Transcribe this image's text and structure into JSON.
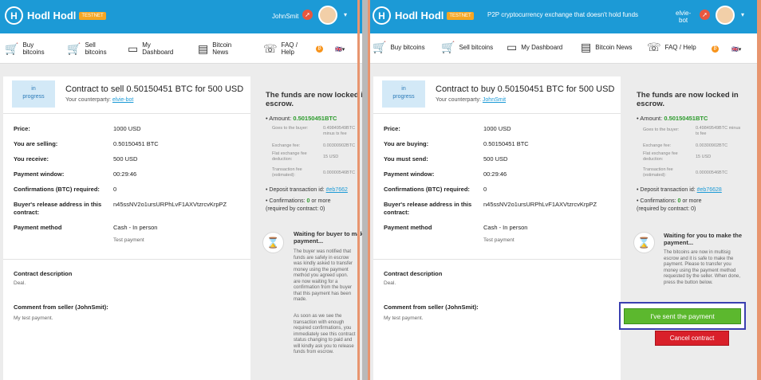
{
  "brand": {
    "name": "Hodl Hodl",
    "badge": "TESTNET"
  },
  "left": {
    "user": "JohnSmit",
    "nav": [
      {
        "label": "Buy\nbitcoins"
      },
      {
        "label": "Sell\nbitcoins"
      },
      {
        "label": "My\nDashboard"
      },
      {
        "label": "Bitcoin\nNews"
      },
      {
        "label": "FAQ /\nHelp"
      }
    ],
    "status": "in\nprogress",
    "title": "Contract to sell 0.50150451 BTC for 500 USD",
    "counterparty_label": "Your counterparty:",
    "counterparty": "elvie-bot",
    "rows": [
      {
        "label": "Price:",
        "value": "1000 USD"
      },
      {
        "label": "You are selling:",
        "value": "0.50150451 BTC"
      },
      {
        "label": "You receive:",
        "value": "500 USD"
      },
      {
        "label": "Payment window:",
        "value": "00:29:46"
      },
      {
        "label": "Confirmations (BTC) required:",
        "value": "0"
      },
      {
        "label": "Buyer's release address in this\ncontract:",
        "value": "n45ssNV2o1ursURPhLvF1AXVtzrcvKrpPZ"
      },
      {
        "label": "Payment method",
        "value": "Cash - In person",
        "sub": "Test payment"
      }
    ],
    "desc_h": "Contract description",
    "desc": "Deal.",
    "comment_h": "Comment from seller (JohnSmit):",
    "comment": "My test payment.",
    "side_h": "The funds are now locked in\nescrow.",
    "amount_label": "Amount:",
    "amount": "0.50150451BTC",
    "fees": [
      {
        "k": "Goes to the buyer:",
        "v": "0.49849549BTC\nminus tx fee"
      },
      {
        "k": "Exchange fee:",
        "v": "0.00300902BTC"
      },
      {
        "k": "Flat exchange fee\ndeduction:",
        "v": "15 USD"
      },
      {
        "k": "Transaction fee\n(estimated):",
        "v": "0.00000546BTC"
      }
    ],
    "dep_label": "Deposit transaction id:",
    "dep": "#eb7662",
    "conf": "Confirmations:",
    "conf_v": "0",
    "conf_rest": "or more\n(required by contract: 0)",
    "wait_h": "Waiting for buyer to make\npayment...",
    "wait_p1": "The buyer was notified that\nfunds are safely in escrow\nwas kindly asked to transfer\nmoney using the payment\nmethod you agreed upon.\nare now waiting for a\nconfirmation from the buyer\nthat this payment has been\nmade.",
    "wait_p2": "As soon as we see the\ntransaction with enough\nrequired confirmations, you\nimmediately see this contract\nstatus changing to paid and\nwill kindly ask you to release\nfunds from escrow."
  },
  "right": {
    "tagline": "P2P cryptocurrency exchange that doesn't hold funds",
    "user": "elvie-\nbot",
    "nav": [
      {
        "label": "Buy bitcoins"
      },
      {
        "label": "Sell bitcoins"
      },
      {
        "label": "My Dashboard"
      },
      {
        "label": "Bitcoin News"
      },
      {
        "label": "FAQ / Help"
      }
    ],
    "status": "in\nprogress",
    "title": "Contract to buy 0.50150451 BTC for 500 USD",
    "counterparty_label": "Your counterparty:",
    "counterparty": "JohnSmit",
    "rows": [
      {
        "label": "Price:",
        "value": "1000 USD"
      },
      {
        "label": "You are buying:",
        "value": "0.50150451 BTC"
      },
      {
        "label": "You must send:",
        "value": "500 USD"
      },
      {
        "label": "Payment window:",
        "value": "00:29:46"
      },
      {
        "label": "Confirmations (BTC) required:",
        "value": "0"
      },
      {
        "label": "Buyer's release address in this\ncontract:",
        "value": "n45ssNV2o1ursURPhLvF1AXVtzrcvKrpPZ"
      },
      {
        "label": "Payment method",
        "value": "Cash - In person",
        "sub": "Test payment"
      }
    ],
    "desc_h": "Contract description",
    "desc": "Deal.",
    "comment_h": "Comment from seller (JohnSmit):",
    "comment": "My test payment.",
    "side_h": "The funds are now locked in\nescrow.",
    "amount_label": "Amount:",
    "amount": "0.50150451BTC",
    "fees": [
      {
        "k": "Goes to the buyer:",
        "v": "0.49849549BTC minus\ntx fee"
      },
      {
        "k": "Exchange fee:",
        "v": "0.00300902BTC"
      },
      {
        "k": "Flat exchange fee\ndeduction:",
        "v": "15 USD"
      },
      {
        "k": "Transaction fee\n(estimated):",
        "v": "0.00000546BTC"
      }
    ],
    "dep_label": "Deposit transaction id:",
    "dep": "#eb76628",
    "conf": "Confirmations:",
    "conf_v": "0",
    "conf_rest": "or more\n(required by contract: 0)",
    "wait_h": "Waiting for you to make the\npayment...",
    "wait_p": "The bitcoins are now in multisig\nescrow and it is safe to make the\npayment. Please to transfer you\nmoney using the payment method\nrequested by the seller. When done,\npress the button below.",
    "btn_sent": "I've sent the payment",
    "btn_cancel": "Cancel contract"
  }
}
